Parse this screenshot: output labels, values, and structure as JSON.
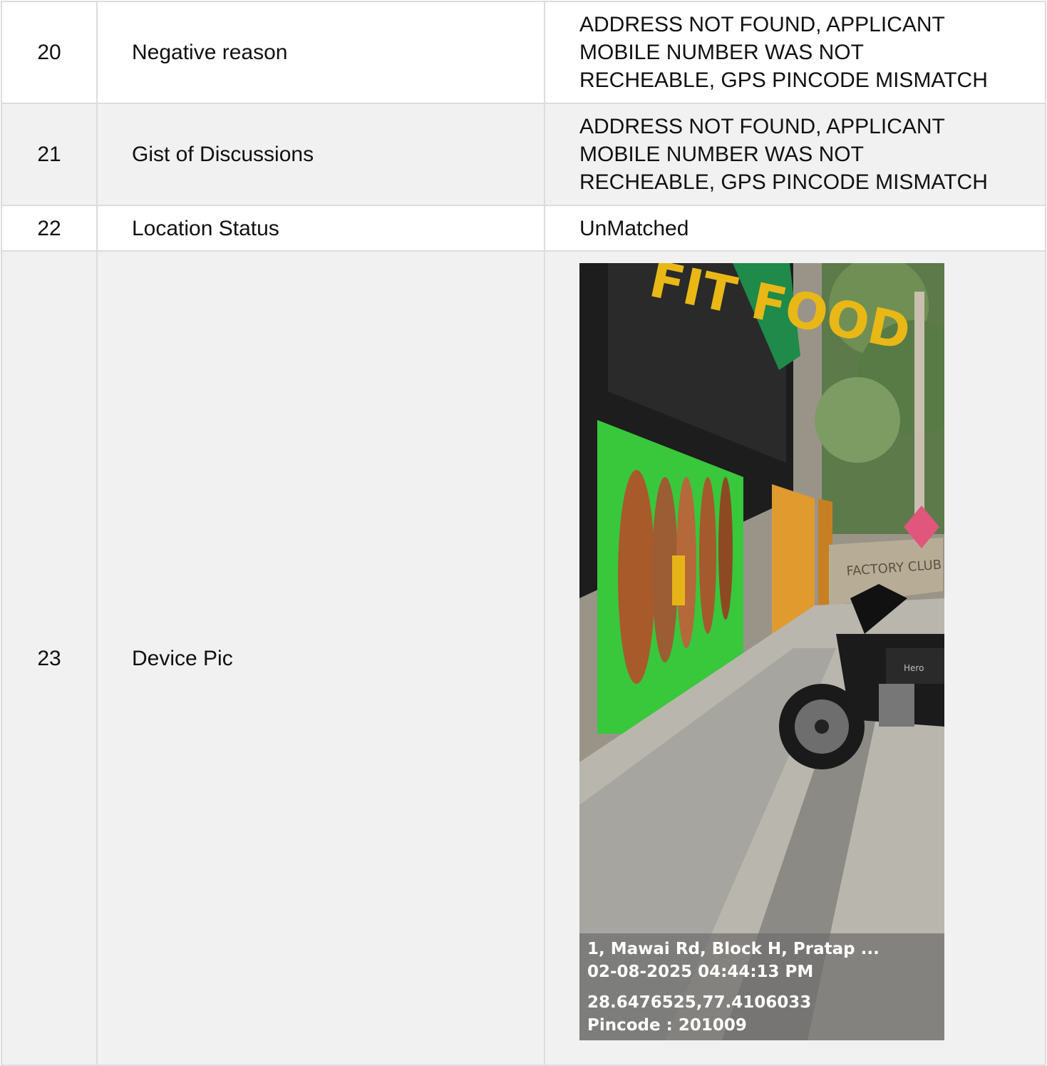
{
  "rows": [
    {
      "no": "20",
      "label": "Negative reason",
      "value_lines": [
        "ADDRESS NOT FOUND, APPLICANT",
        "MOBILE NUMBER WAS NOT",
        "RECHEABLE, GPS PINCODE MISMATCH"
      ]
    },
    {
      "no": "21",
      "label": "Gist of Discussions",
      "value_lines": [
        "ADDRESS NOT FOUND, APPLICANT",
        "MOBILE NUMBER WAS NOT",
        "RECHEABLE, GPS PINCODE MISMATCH"
      ]
    },
    {
      "no": "22",
      "label": "Location Status",
      "value": "UnMatched"
    },
    {
      "no": "23",
      "label": "Device Pic"
    }
  ],
  "photo": {
    "overlay": {
      "address": "1, Mawai Rd, Block H, Pratap ...",
      "datetime": "02-08-2025 04:44:13 PM",
      "coordinates": "28.6476525,77.4106033",
      "pincode": "Pincode : 201009"
    },
    "scene_text": {
      "shop_sign": "FIT FOOD",
      "hoarding": "FACTORY CLUB",
      "bike_brand": "Hero"
    }
  }
}
